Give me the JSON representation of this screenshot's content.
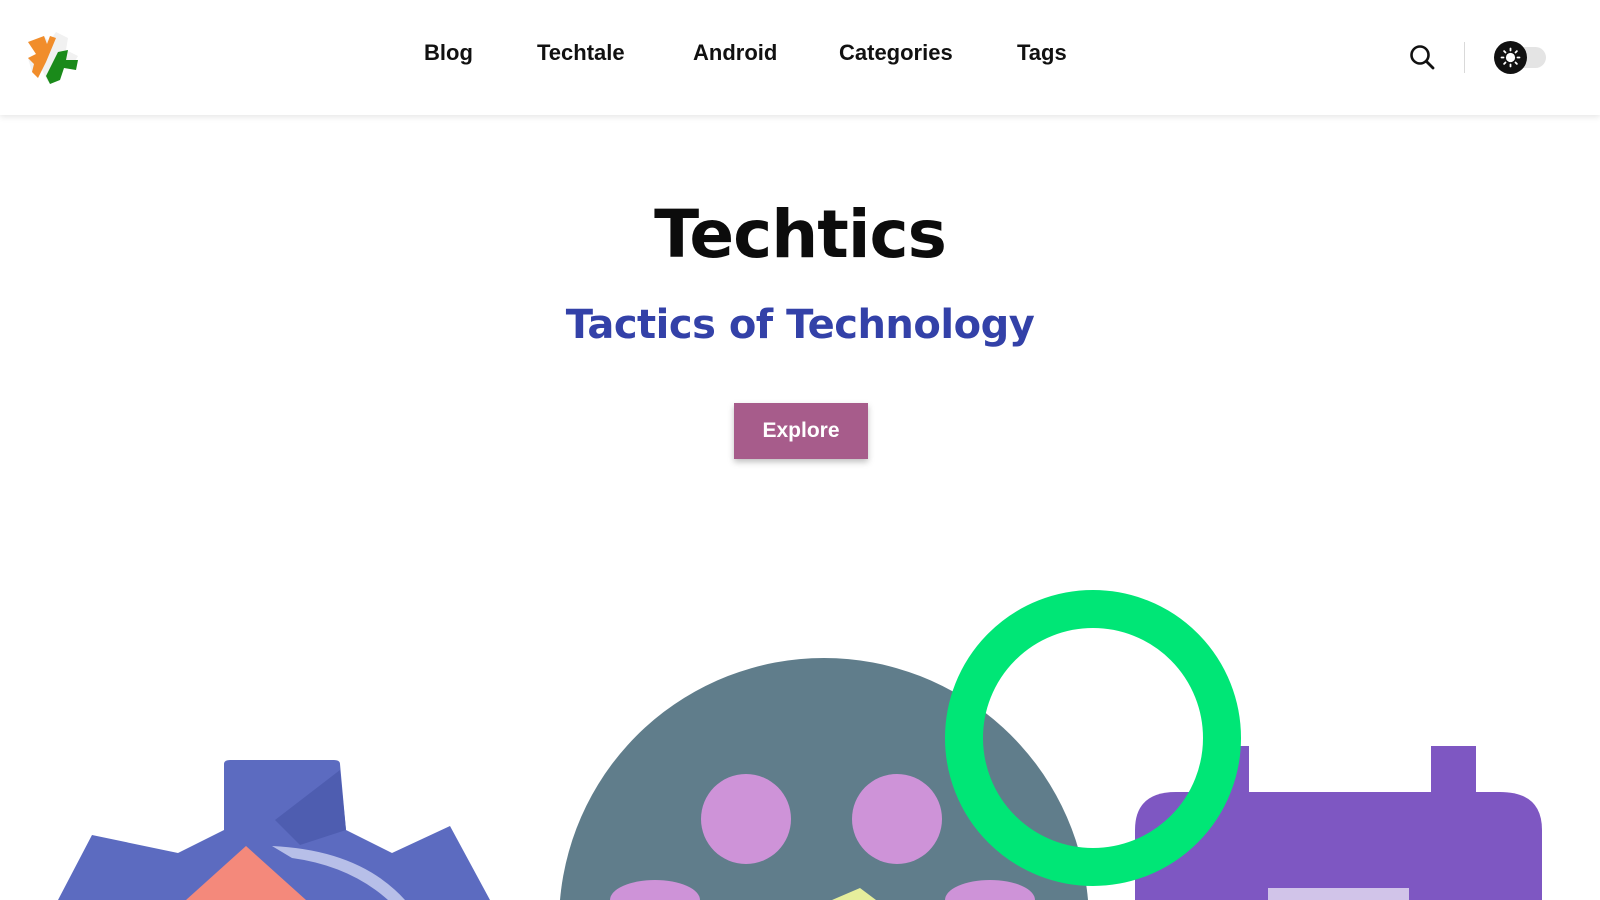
{
  "header": {
    "logo_icon": "techtics-puzzle-logo",
    "nav": [
      {
        "label": "Blog"
      },
      {
        "label": "Techtale"
      },
      {
        "label": "Android"
      },
      {
        "label": "Categories"
      },
      {
        "label": "Tags"
      }
    ],
    "search_icon": "search-icon",
    "theme_toggle_icon": "sun-icon"
  },
  "hero": {
    "title": "Techtics",
    "subtitle": "Tactics of Technology",
    "cta_label": "Explore"
  },
  "colors": {
    "subtitle": "#3341a8",
    "cta_background": "#a75c8b",
    "gear": "#5c6bc0",
    "reel": "#607d8b",
    "reel_holes": "#ce93d8",
    "ring": "#00e676",
    "calendar": "#7e57c2"
  },
  "illustrations": [
    "gear-illustration",
    "film-reel-illustration",
    "ring-illustration",
    "calendar-illustration"
  ]
}
